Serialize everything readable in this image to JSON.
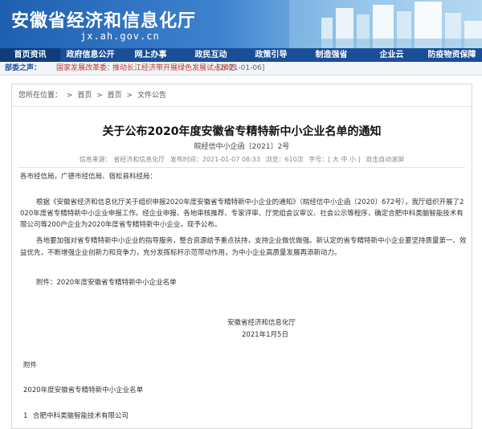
{
  "header": {
    "site_title": "安徽省经济和信息化厅",
    "site_domain": "jx.ah.gov.cn",
    "nav": [
      {
        "label": "首页资讯",
        "active": true
      },
      {
        "label": "政府信息公开"
      },
      {
        "label": "网上办事"
      },
      {
        "label": "政民互动"
      },
      {
        "label": "政策引导"
      },
      {
        "label": "制造强省"
      },
      {
        "label": "企业云"
      },
      {
        "label": "防疫物资保障"
      }
    ]
  },
  "ticker": {
    "label": "部委之声：",
    "text1": "国家发展改革委：",
    "text2": "推动长江经济带开展绿色发展试点示范",
    "date": "[2021-01-06]"
  },
  "breadcrumb": {
    "prefix": "您所在位置：",
    "items": [
      "首页",
      "首页",
      "文件公告"
    ],
    "separator": ">"
  },
  "article": {
    "title": "关于公布2020年度安徽省专精特新中小企业名单的通知",
    "doc_number": "皖经信中小企函〔2021〕2号",
    "meta": {
      "source": "信息来源：  省经济和信息化厅",
      "published": "发布时间：2021-01-07 08:33",
      "views": "浏览：610次",
      "font_size": "字号：[ 大  中  小 ]",
      "tip": "双击自动滚屏"
    },
    "salutation": "各市经信局，广德市经信局、宿松县科经局：",
    "para1_lines": [
      "根据《安徽省经济和信息化厅关于组织申报2020年度安徽省专精特新中小企业的通知》（皖经信中小企函〔2020〕672号），我厅组织开展了2",
      "020年度省专精特新中小企业申报工作。经企业申报、各地审核推荐、专家评审、厅党组会议审议、社会公示等程序，确定合肥中科类脑智能技术有",
      "限公司等200户企业为2020年度省专精特新中小企业，现予公布。"
    ],
    "para2_lines": [
      "各地要加强对省专精特新中小企业的指导服务，整合资源给予重点扶持，支持企业做优做强。新认定的省专精特新中小企业要坚持质量第一、效",
      "益优先，不断增强企业创新力和竞争力，充分发挥标杆示范带动作用，为中小企业高质量发展再添新动力。"
    ],
    "attachment_line": "附件：2020年度安徽省专精特新中小企业名单",
    "signature_org": "安徽省经济和信息化厅",
    "signature_date": "2021年1月5日",
    "appendix_heading": "附件",
    "appendix_title": "2020年度安徽省专精特新中小企业名单",
    "appendix_item1_num": "1",
    "appendix_item1_name": "合肥中科类脑智能技术有限公司"
  }
}
